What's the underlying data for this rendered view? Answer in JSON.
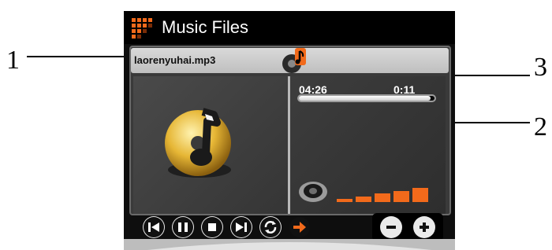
{
  "callouts": {
    "c1": "1",
    "c2": "2",
    "c3": "3"
  },
  "app": {
    "title": "Music Files"
  },
  "track": {
    "filename": "laorenyuhai.mp3"
  },
  "time": {
    "elapsed": "04:26",
    "total": "0:11"
  },
  "playback": {
    "progress_fraction": 0.97
  },
  "volume": {
    "bars": 5,
    "level_fraction": 1.0
  },
  "controls": {
    "buttons": [
      "previous",
      "pause",
      "stop",
      "next",
      "repeat",
      "forward-arrow"
    ],
    "zoom": [
      "minus",
      "plus"
    ]
  },
  "colors": {
    "accent": "#f26a1b",
    "disc_gold": "#d9a92a",
    "panel": "#3a3a3a",
    "header": "#000000"
  }
}
